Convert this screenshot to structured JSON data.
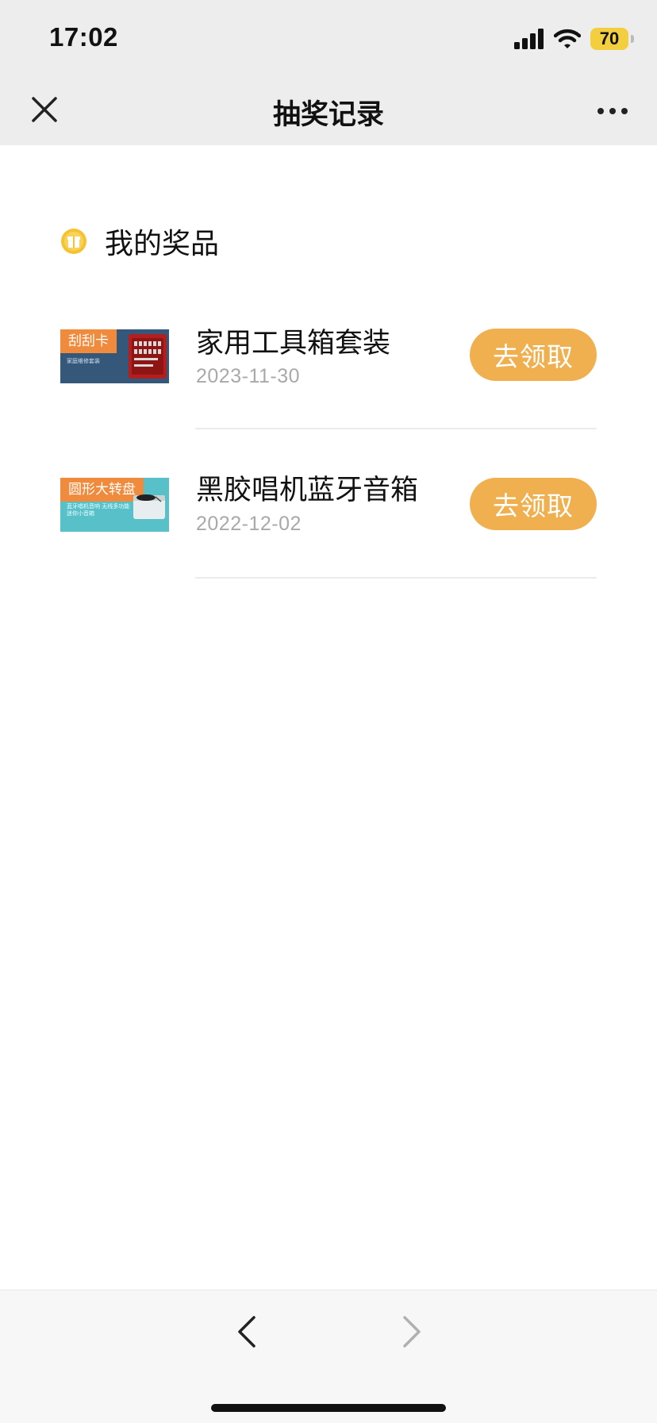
{
  "status_bar": {
    "time": "17:02",
    "battery": "70"
  },
  "nav": {
    "title": "抽奖记录"
  },
  "section": {
    "title": "我的奖品"
  },
  "prizes": [
    {
      "tag": "刮刮卡",
      "thumb_text": "家庭维修套装",
      "name": "家用工具箱套装",
      "date": "2023-11-30",
      "button": "去领取"
    },
    {
      "tag": "圆形大转盘",
      "thumb_text": "蓝牙唱机音响 无线多功能迷你小音箱",
      "name": "黑胶唱机蓝牙音箱",
      "date": "2022-12-02",
      "button": "去领取"
    }
  ],
  "colors": {
    "accent": "#f0b04f",
    "tag": "#f08a3c",
    "battery": "#f3cf3f"
  }
}
